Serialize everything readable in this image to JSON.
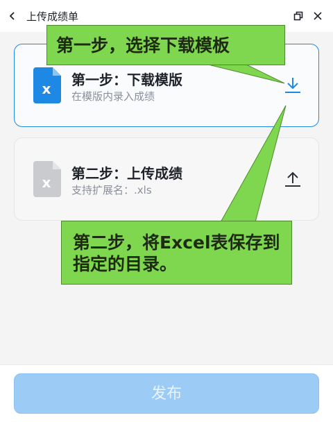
{
  "header": {
    "title": "上传成绩单",
    "back_icon": "chevron-left-icon",
    "restore_icon": "restore-window-icon",
    "close_icon": "close-icon"
  },
  "steps": [
    {
      "title": "第一步：下载模版",
      "subtitle": "在模版内录入成绩",
      "file_icon": "excel-file-icon",
      "file_icon_color": "#1e88e5",
      "action_icon": "download-icon",
      "action_color": "#1e88e5",
      "active": true
    },
    {
      "title": "第二步：上传成绩",
      "subtitle": "支持扩展名：.xls",
      "file_icon": "excel-file-icon",
      "file_icon_color": "#c9cbcf",
      "action_icon": "upload-icon",
      "action_color": "#2b2f36",
      "active": false
    }
  ],
  "annotations": [
    {
      "text": "第一步，选择下载模板",
      "color": "#7fd64f"
    },
    {
      "text": "第二步，将Excel表保存到指定的目录。",
      "color": "#7fd64f"
    }
  ],
  "footer": {
    "publish_label": "发布",
    "publish_enabled": false,
    "publish_color": "#9ccbf5"
  }
}
